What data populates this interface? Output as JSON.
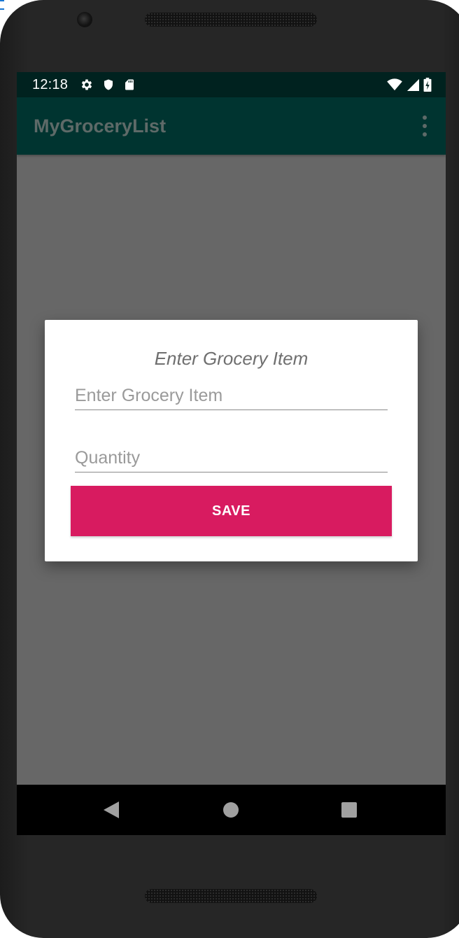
{
  "status_bar": {
    "time": "12:18",
    "left_icons": [
      "gear-icon",
      "shield-icon",
      "sd-card-icon"
    ],
    "right_icons": [
      "wifi-icon",
      "cell-signal-icon",
      "battery-charging-icon"
    ]
  },
  "app_bar": {
    "title": "MyGroceryList",
    "menu_icon": "more-vert-icon"
  },
  "dialog": {
    "title": "Enter Grocery Item",
    "item_field": {
      "placeholder": "Enter Grocery Item",
      "value": ""
    },
    "quantity_field": {
      "placeholder": "Quantity",
      "value": ""
    },
    "save_label": "SAVE"
  },
  "nav_bar": {
    "icons": [
      "back-icon",
      "home-icon",
      "recents-icon"
    ]
  },
  "colors": {
    "status_bar": "#00221f",
    "app_bar": "#003430",
    "scrim": "#676767",
    "accent": "#d81b60"
  }
}
